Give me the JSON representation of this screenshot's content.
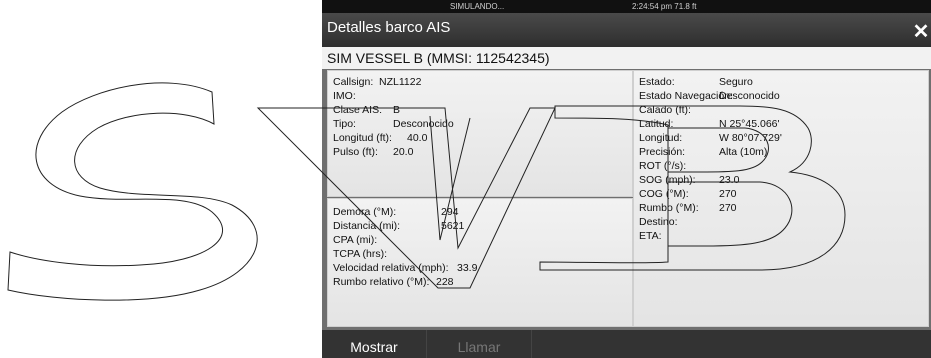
{
  "status": {
    "left": "SIMULANDO...",
    "right": "2:24:54 pm   71.8 ft"
  },
  "window": {
    "title": "Detalles barco AIS",
    "close_glyph": "✕"
  },
  "vessel_heading": "SIM VESSEL B (MMSI: 112542345)",
  "left_top": [
    {
      "label": "Callsign:",
      "value": "NZL1122"
    },
    {
      "label": "IMO:",
      "value": ""
    },
    {
      "label": "Clase AIS:",
      "value": "B"
    },
    {
      "label": "Tipo:",
      "value": "Desconocido"
    },
    {
      "label": "Longitud (ft):",
      "value": "40.0"
    },
    {
      "label": "Pulso (ft):",
      "value": "20.0"
    }
  ],
  "left_bottom": [
    {
      "label": "Demora (°M):",
      "value": "294"
    },
    {
      "label": "Distancia (mi):",
      "value": "5621"
    },
    {
      "label": "CPA (mi):",
      "value": ""
    },
    {
      "label": "TCPA (hrs):",
      "value": ""
    },
    {
      "label": "Velocidad relativa (mph):",
      "value": "33.9"
    },
    {
      "label": "Rumbo relativo (°M):",
      "value": "228"
    }
  ],
  "right": [
    {
      "label": "Estado:",
      "value": "Seguro"
    },
    {
      "label": "Estado Navegación:",
      "value": "Desconocido"
    },
    {
      "label": "Calado (ft):",
      "value": ""
    },
    {
      "label": "Latitud:",
      "value": "N 25°45.066'"
    },
    {
      "label": "Longitud:",
      "value": "W 80°07.729'"
    },
    {
      "label": "Precisión:",
      "value": "Alta (10m)"
    },
    {
      "label": "ROT (°/s):",
      "value": ""
    },
    {
      "label": "SOG (mph):",
      "value": "23.0"
    },
    {
      "label": "COG (°M):",
      "value": "270"
    },
    {
      "label": "Rumbo (°M):",
      "value": "270"
    },
    {
      "label": "Destino:",
      "value": ""
    },
    {
      "label": "ETA:",
      "value": ""
    }
  ],
  "buttons": {
    "mostrar": "Mostrar",
    "llamar": "Llamar"
  },
  "logo_icon": "svb-outline-logo"
}
